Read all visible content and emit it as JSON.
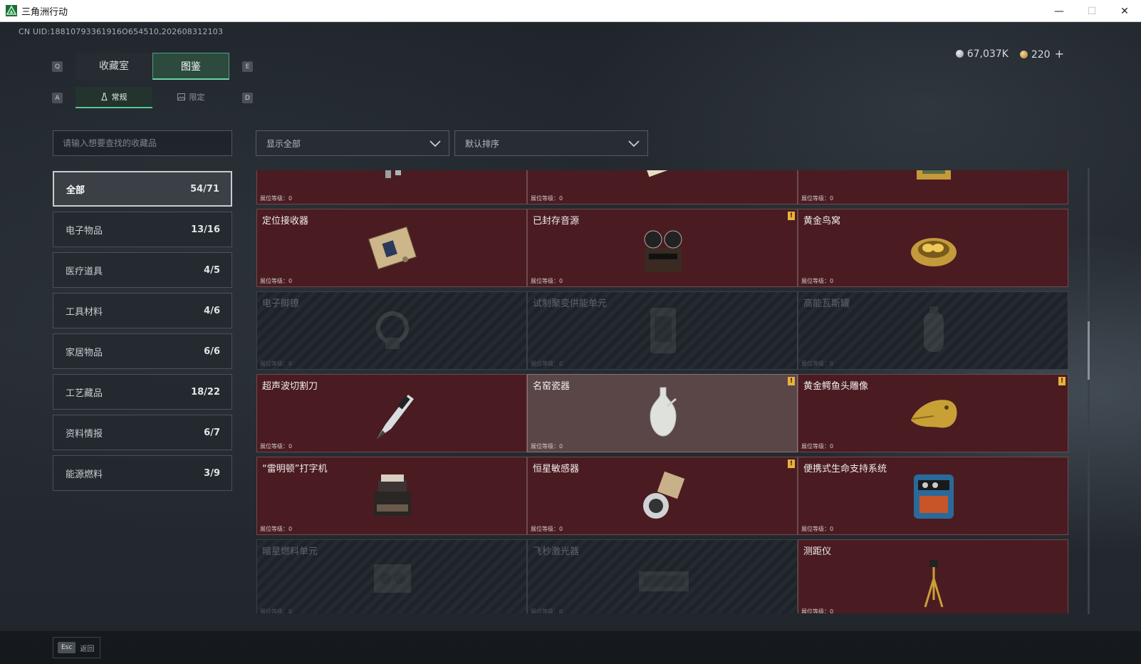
{
  "window": {
    "title": "三角洲行动",
    "controls": [
      "—",
      "☐",
      "✕"
    ]
  },
  "uid": "CN UID:18810793361916O654510,202608312103",
  "currency": {
    "silver": "67,037K",
    "gold": "220",
    "plus": "+"
  },
  "hotkeys": {
    "tab_prev": "Q",
    "tab_next": "E",
    "sub_prev": "A",
    "sub_next": "D",
    "back": "Esc"
  },
  "tabs": [
    {
      "label": "收藏室",
      "active": false
    },
    {
      "label": "图鉴",
      "active": true
    }
  ],
  "subtabs": [
    {
      "label": "常规",
      "active": true
    },
    {
      "label": "限定",
      "active": false
    }
  ],
  "search": {
    "placeholder": "请输入想要查找的收藏品"
  },
  "filters": {
    "show": "显示全部",
    "sort": "默认排序"
  },
  "categories": [
    {
      "name": "全部",
      "count": "54/71",
      "active": true
    },
    {
      "name": "电子物品",
      "count": "13/16"
    },
    {
      "name": "医疗道具",
      "count": "4/5"
    },
    {
      "name": "工具材料",
      "count": "4/6"
    },
    {
      "name": "家居物品",
      "count": "6/6"
    },
    {
      "name": "工艺藏品",
      "count": "18/22"
    },
    {
      "name": "资料情报",
      "count": "6/7"
    },
    {
      "name": "能源燃料",
      "count": "3/9"
    }
  ],
  "level_label": "展位等级：0",
  "items": [
    {
      "name": "",
      "locked": false,
      "flag": false,
      "icon": "canister-icon"
    },
    {
      "name": "",
      "locked": false,
      "flag": false,
      "icon": "painting-plate-icon"
    },
    {
      "name": "",
      "locked": false,
      "flag": false,
      "icon": "framed-painting-icon"
    },
    {
      "name": "定位接收器",
      "locked": false,
      "flag": false,
      "icon": "receiver-icon"
    },
    {
      "name": "已封存音源",
      "locked": false,
      "flag": true,
      "icon": "reel-recorder-icon"
    },
    {
      "name": "黄金鸟窝",
      "locked": false,
      "flag": false,
      "icon": "golden-nest-icon"
    },
    {
      "name": "电子脚镣",
      "locked": true,
      "flag": false,
      "icon": "shackle-icon"
    },
    {
      "name": "试制聚变供能单元",
      "locked": true,
      "flag": false,
      "icon": "fusion-unit-icon"
    },
    {
      "name": "高能瓦斯罐",
      "locked": true,
      "flag": false,
      "icon": "gas-tank-icon"
    },
    {
      "name": "超声波切割刀",
      "locked": false,
      "flag": false,
      "icon": "ultrasonic-knife-icon"
    },
    {
      "name": "名窑瓷器",
      "locked": false,
      "flag": true,
      "icon": "porcelain-vase-icon",
      "highlight": true
    },
    {
      "name": "黄金鳄鱼头雕像",
      "locked": false,
      "flag": true,
      "icon": "golden-croc-icon"
    },
    {
      "name": "“雷明顿”打字机",
      "locked": false,
      "flag": false,
      "icon": "typewriter-icon"
    },
    {
      "name": "恒星敏感器",
      "locked": false,
      "flag": true,
      "icon": "star-sensor-icon"
    },
    {
      "name": "便携式生命支持系统",
      "locked": false,
      "flag": false,
      "icon": "life-support-icon"
    },
    {
      "name": "暗星燃料单元",
      "locked": true,
      "flag": false,
      "icon": "fuel-unit-icon"
    },
    {
      "name": "飞秒激光器",
      "locked": true,
      "flag": false,
      "icon": "laser-icon"
    },
    {
      "name": "测距仪",
      "locked": false,
      "flag": false,
      "icon": "rangefinder-icon"
    }
  ],
  "back_label": "返回",
  "colors": {
    "accent": "#6bd3a2",
    "owned_card": "#4a1c21",
    "flag": "#e9b23a"
  }
}
